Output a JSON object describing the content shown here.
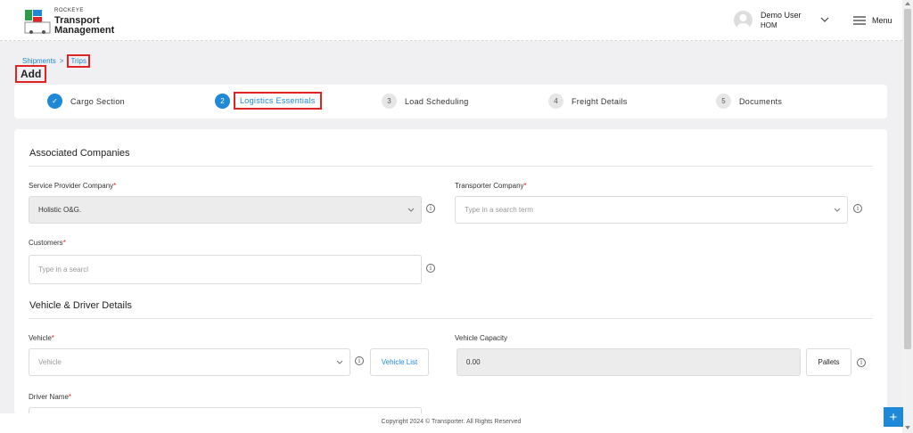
{
  "brand": {
    "small": "ROCKEYE",
    "line1": "Transport",
    "line2": "Management"
  },
  "user": {
    "name": "Demo User",
    "role": "HOM"
  },
  "menu_label": "Menu",
  "breadcrumb": {
    "parent": "Shipments",
    "separator": ">",
    "current": "Trips"
  },
  "page_title": "Add",
  "steps": [
    {
      "num": "✓",
      "label": "Cargo Section",
      "state": "done"
    },
    {
      "num": "2",
      "label": "Logistics Essentials",
      "state": "active"
    },
    {
      "num": "3",
      "label": "Load Scheduling",
      "state": "pending"
    },
    {
      "num": "4",
      "label": "Freight Details",
      "state": "pending"
    },
    {
      "num": "5",
      "label": "Documents",
      "state": "pending"
    }
  ],
  "associated": {
    "title": "Associated Companies",
    "service_provider": {
      "label": "Service Provider Company",
      "value": "Holistic O&G."
    },
    "transporter": {
      "label": "Transporter Company",
      "placeholder": "Type in a search term"
    },
    "customers": {
      "label": "Customers",
      "placeholder": "Type in a searcl"
    }
  },
  "vehicle_driver": {
    "title": "Vehicle & Driver Details",
    "vehicle": {
      "label": "Vehicle",
      "placeholder": "Vehicle"
    },
    "vehicle_list_button": "Vehicle List",
    "capacity": {
      "label": "Vehicle Capacity",
      "value": "0.00"
    },
    "pallets_button": "Pallets",
    "driver": {
      "label": "Driver Name"
    }
  },
  "required_mark": "*",
  "info_glyph": "i",
  "footer": "Copyright 2024 © Transporter. All Rights Reserved",
  "fab_glyph": "+",
  "colors": {
    "accent": "#1e88d9",
    "highlight": "#e02424",
    "background": "#f0f0f2"
  }
}
